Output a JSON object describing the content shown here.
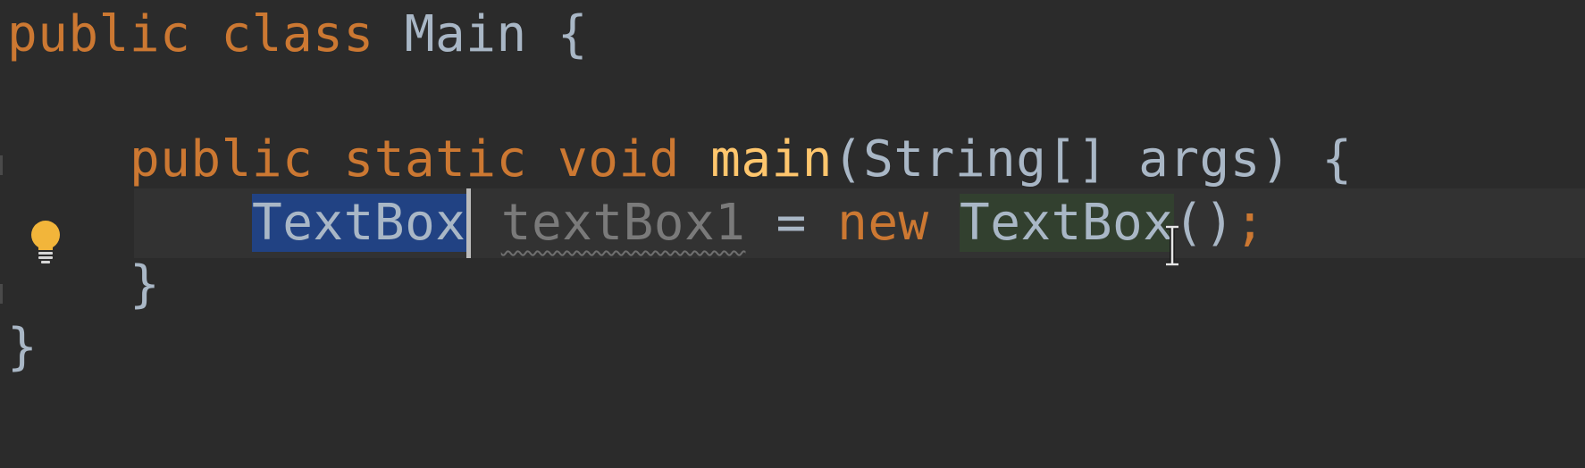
{
  "editor": {
    "lines": [
      {
        "tokens": [
          {
            "text": "public",
            "kind": "keyword"
          },
          {
            "text": " ",
            "kind": "plain"
          },
          {
            "text": "class",
            "kind": "keyword"
          },
          {
            "text": " Main {",
            "kind": "plain"
          }
        ]
      },
      {
        "tokens": []
      },
      {
        "tokens": [
          {
            "text": "public",
            "kind": "keyword"
          },
          {
            "text": " ",
            "kind": "plain"
          },
          {
            "text": "static",
            "kind": "keyword"
          },
          {
            "text": " ",
            "kind": "plain"
          },
          {
            "text": "void",
            "kind": "keyword"
          },
          {
            "text": " ",
            "kind": "plain"
          },
          {
            "text": "main",
            "kind": "function"
          },
          {
            "text": "(String[] args) {",
            "kind": "plain"
          }
        ]
      },
      {
        "tokens": [
          {
            "text": "TextBox",
            "kind": "selected"
          },
          {
            "text": "",
            "kind": "caret"
          },
          {
            "text": " ",
            "kind": "plain"
          },
          {
            "text": "textBox1",
            "kind": "unused"
          },
          {
            "text": " = ",
            "kind": "plain"
          },
          {
            "text": "new",
            "kind": "keyword"
          },
          {
            "text": " ",
            "kind": "plain"
          },
          {
            "text": "TextBox",
            "kind": "highlight"
          },
          {
            "text": "()",
            "kind": "plain"
          },
          {
            "text": ";",
            "kind": "keyword"
          }
        ]
      },
      {
        "tokens": [
          {
            "text": "}",
            "kind": "plain"
          }
        ]
      },
      {
        "tokens": [
          {
            "text": "}",
            "kind": "plain"
          }
        ]
      }
    ]
  },
  "icons": {
    "intention": "lightbulb-icon",
    "cursor": "i-beam-cursor-icon"
  },
  "colors": {
    "background": "#2b2b2b",
    "current_line": "#323232",
    "keyword": "#cc7832",
    "plain": "#a9b7c6",
    "function": "#ffc66d",
    "unused": "#7a7a7a",
    "selection": "#214283",
    "usage_highlight": "#32402f",
    "bulb": "#f2b53a"
  }
}
